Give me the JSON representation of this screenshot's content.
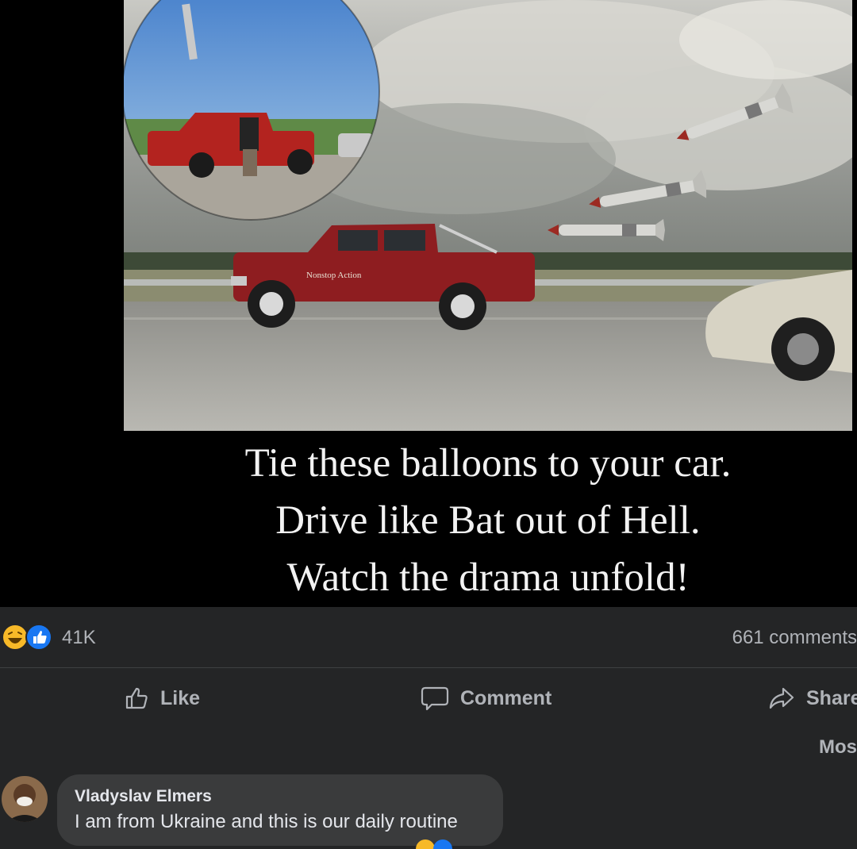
{
  "post": {
    "caption_lines": [
      "Tie these balloons to your car.",
      "Drive like Bat out of Hell.",
      "Watch the drama unfold!"
    ],
    "truck_decal": "Nonstop Action"
  },
  "reactions": {
    "count": "41K",
    "icons": [
      "haha-icon",
      "like-icon"
    ],
    "comments_count": "661 comments"
  },
  "actions": {
    "like": "Like",
    "comment": "Comment",
    "share": "Share"
  },
  "sort_label": "Mos",
  "comment": {
    "author": "Vladyslav Elmers",
    "text": "I am from Ukraine and this is our daily routine"
  },
  "colors": {
    "background": "#242526",
    "text_secondary": "#b0b3b8",
    "like_blue": "#1877f2",
    "haha_yellow": "#f7b928",
    "bubble": "#3a3b3c"
  }
}
